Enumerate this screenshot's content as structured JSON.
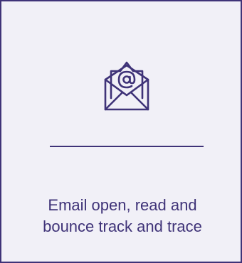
{
  "card": {
    "icon": "email-open-at-icon",
    "caption_line1": "Email open, read and",
    "caption_line2": "bounce track and trace"
  },
  "colors": {
    "accent": "#3f3378",
    "background": "#f1f0f7"
  }
}
